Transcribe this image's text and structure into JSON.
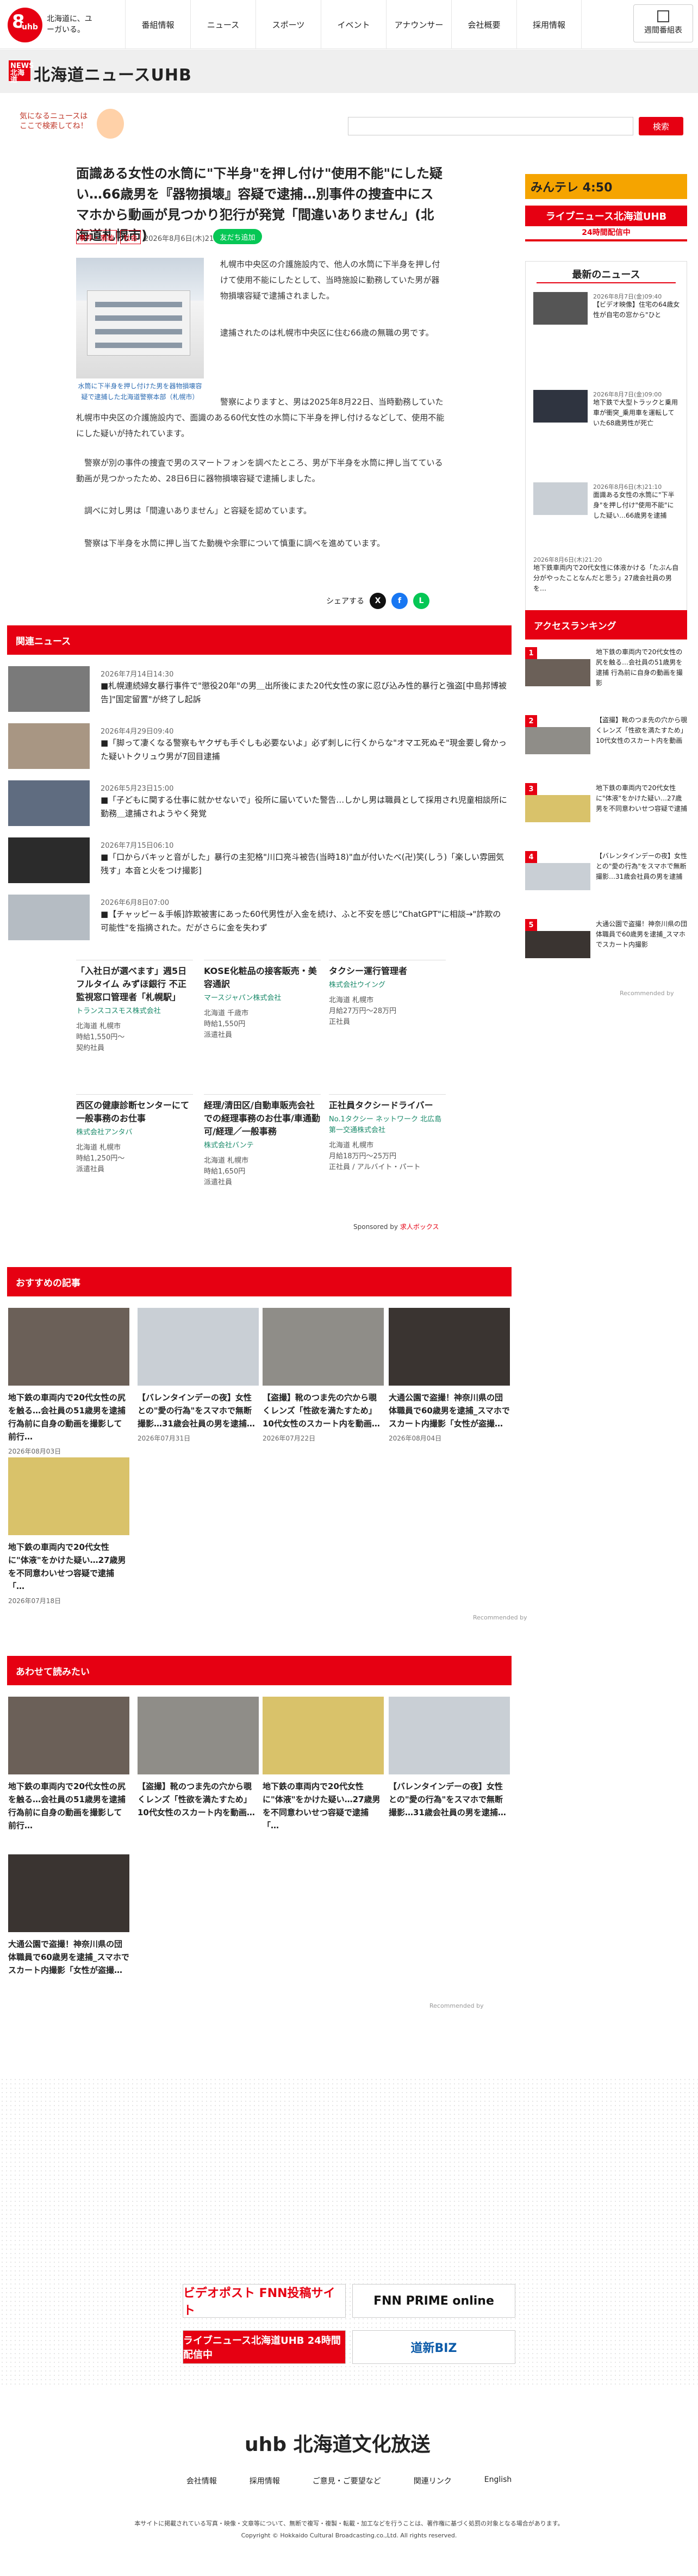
{
  "header": {
    "logo_text": "8 uhb",
    "tagline": "北海道に、ユーガいる。",
    "nav": [
      "番組情報",
      "ニュース",
      "スポーツ",
      "イベント",
      "アナウンサー",
      "会社概要",
      "採用情報"
    ],
    "week_button": "週間番組表"
  },
  "brand": {
    "badge": "NEWS 北海道",
    "title": "北海道ニュースUHB"
  },
  "search": {
    "character_text": "気になるニュースは ここで検索してね！",
    "placeholder": "",
    "button": "検索"
  },
  "article": {
    "title": "面識ある女性の水筒に\"下半身\"を押し付け\"使用不能\"にした疑い…66歳男を『器物損壊』容疑で逮捕…別事件の捜査中にスマホから動画が見つかり犯行が発覚「間違いありません」(北海道札幌市)",
    "tags": [
      "事件・事故",
      "社会"
    ],
    "date": "2026年8月6日(木)21:10",
    "follow": "友だち追加",
    "caption": "水筒に下半身を押し付けた男を器物損壊容疑で逮捕した北海道警察本部（札幌市）",
    "paragraphs": [
      "札幌市中央区の介護施設内で、他人の水筒に下半身を押し付けて使用不能にしたとして、当時施設に勤務していた男が器物損壊容疑で逮捕されました。",
      "逮捕されたのは札幌市中央区に住む66歳の無職の男です。",
      "警察によりますと、男は2025年8月22日、当時勤務していた札幌市中央区の介護施設内で、面識のある60代女性の水筒に下半身を押し付けるなどして、使用不能にした疑いが持たれています。",
      "警察が別の事件の捜査で男のスマートフォンを調べたところ、男が下半身を水筒に押し当てている動画が見つかったため、28日6日に器物損壊容疑で逮捕しました。",
      "調べに対し男は「間違いありません」と容疑を認めています。",
      "警察は下半身を水筒に押し当てた動機や余罪について慎重に調べを進めています。"
    ],
    "share_label": "シェアする"
  },
  "related": {
    "heading": "関連ニュース",
    "items": [
      {
        "date": "2026年7月14日14:30",
        "title": "■札幌連続婦女暴行事件で\"懲役20年\"の男＿出所後にまた20代女性の家に忍び込み性的暴行と強盗[中島邦博被告]\"国定留置\"が終了し起訴"
      },
      {
        "date": "2026年4月29日09:40",
        "title": "■「脚って凄くなる警察もヤクザも手ぐしも必要ないよ」必ず刺しに行くからな\"オマエ死ぬそ\"現金要し脅かった疑いトクリュウ男が7回目逮捕"
      },
      {
        "date": "2026年5月23日15:00",
        "title": "■「子どもに関する仕事に就かせないで」役所に届いていた警告…しかし男は職員として採用され児童相談所に勤務＿逮捕されようやく発覚"
      },
      {
        "date": "2026年7月15日06:10",
        "title": "■「口からバキッと音がした」暴行の主犯格\"川口亮斗被告(当時18)\"血が付いたべ(卍)笑(しう)「楽しい雰囲気残す」本音と火をつけ撮影]"
      },
      {
        "date": "2026年6月8日07:00",
        "title": "■【チャッピー＆手帳]詐欺被害にあった60代男性が入金を続け、ふと不安を感じ\"ChatGPT\"に相談→\"詐欺の可能性\"を指摘された。だがさらに金を失わず"
      }
    ]
  },
  "jobs": [
    {
      "title": "「入社日が選べます」週5日フルタイム みずほ銀行 不正監視窓口管理者「札幌駅」",
      "company": "トランスコスモス株式会社",
      "info": [
        "北海道 札幌市",
        "時給1,550円～",
        "契約社員"
      ]
    },
    {
      "title": "KOSE化粧品の接客販売・美容通訳",
      "company": "マースジャパン株式会社",
      "info": [
        "北海道 千歳市",
        "時給1,550円",
        "派遣社員"
      ]
    },
    {
      "title": "タクシー運行管理者",
      "company": "株式会社ウイング",
      "info": [
        "北海道 札幌市",
        "月給27万円～28万円",
        "正社員"
      ]
    },
    {
      "title": "西区の健康診断センターにて一般事務のお仕事",
      "company": "株式会社アンタバ",
      "info": [
        "北海道 札幌市",
        "時給1,250円～",
        "派遣社員"
      ]
    },
    {
      "title": "経理/清田区/自動車販売会社での経理事務のお仕事/車通勤可/経理／一般事務",
      "company": "株式会社バンテ",
      "info": [
        "北海道 札幌市",
        "時給1,650円",
        "派遣社員"
      ]
    },
    {
      "title": "正社員タクシードライバー",
      "company": "No.1タクシー ネットワーク 北広島第一交通株式会社",
      "info": [
        "北海道 札幌市",
        "月給18万円～25万円",
        "正社員 / アルバイト・パート"
      ]
    }
  ],
  "sponsor": {
    "prefix": "Sponsored by",
    "name": "求人ボックス"
  },
  "recommend": {
    "heading": "おすすめの記事",
    "items": [
      {
        "title": "地下鉄の車両内で20代女性の尻を触る…会社員の51歳男を逮捕 行為前に自身の動画を撮影して前行…",
        "date": "2026年08月03日"
      },
      {
        "title": "【バレンタインデーの夜】女性との\"愛の行為\"をスマホで無断撮影…31歳会社員の男を逮捕…",
        "date": "2026年07月31日"
      },
      {
        "title": "【盗撮】靴のつま先の穴から覗くレンズ「性欲を満たすため」10代女性のスカート内を動画…",
        "date": "2026年07月22日"
      },
      {
        "title": "大通公園で盗撮！神奈川県の団体職員で60歳男を逮捕_スマホでスカート内撮影「女性が盗撮…",
        "date": "2026年08月04日"
      },
      {
        "title": "地下鉄の車両内で20代女性に\"体液\"をかけた疑い…27歳男を不同意わいせつ容疑で逮捕「…",
        "date": "2026年07月18日"
      }
    ],
    "powered": "Recommended by"
  },
  "together": {
    "heading": "あわせて読みたい",
    "items": [
      {
        "title": "地下鉄の車両内で20代女性の尻を触る…会社員の51歳男を逮捕 行為前に自身の動画を撮影して前行…"
      },
      {
        "title": "【盗撮】靴のつま先の穴から覗くレンズ「性欲を満たすため」10代女性のスカート内を動画…"
      },
      {
        "title": "地下鉄の車両内で20代女性に\"体液\"をかけた疑い…27歳男を不同意わいせつ容疑で逮捕「…"
      },
      {
        "title": "【バレンタインデーの夜】女性との\"愛の行為\"をスマホで無断撮影…31歳会社員の男を逮捕…"
      },
      {
        "title": "大通公園で盗撮！神奈川県の団体職員で60歳男を逮捕_スマホでスカート内撮影「女性が盗撮…"
      }
    ],
    "powered": "Recommended by"
  },
  "sidebar": {
    "promo": "みんテレ 4:50",
    "live": "ライブニュース北海道UHB",
    "live_sub": "24時間配信中",
    "new_heading": "最新のニュース",
    "news": [
      {
        "date": "2026年8月7日(金)09:40",
        "title": "【ビデオ映像】住宅の64歳女性が自宅の窓から\"ひと"
      },
      {
        "date": "2026年8月7日(金)09:00",
        "title": "地下鉄で大型トラックと乗用車が衝突_乗用車を運転していた68歳男性が死亡"
      },
      {
        "date": "2026年8月6日(木)21:10",
        "title": "面識ある女性の水筒に\"下半身\"を押し付け\"使用不能\"にした疑い…66歳男を逮捕"
      },
      {
        "date": "2026年8月6日(木)21:20",
        "title": "地下鉄車両内で20代女性に体液かける「たぶん自分がやったことなんだと思う」27歳会社員の男を…"
      }
    ],
    "ranking_heading": "アクセスランキング",
    "ranking": [
      {
        "rank": "1",
        "title": "地下鉄の車両内で20代女性の尻を触る…会社員の51歳男を逮捕 行為前に自身の動画を撮影"
      },
      {
        "rank": "2",
        "title": "【盗撮】靴のつま先の穴から覗くレンズ「性欲を満たすため」10代女性のスカート内を動画"
      },
      {
        "rank": "3",
        "title": "地下鉄の車両内で20代女性に\"体液\"をかけた疑い…27歳男を不同意わいせつ容疑で逮捕"
      },
      {
        "rank": "4",
        "title": "【バレンタインデーの夜】女性との\"愛の行為\"をスマホで無断撮影…31歳会社員の男を逮捕"
      },
      {
        "rank": "5",
        "title": "大通公園で盗撮！神奈川県の団体職員で60歳男を逮捕_スマホでスカート内撮影"
      }
    ],
    "ranking_powered": "Recommended by"
  },
  "banners": {
    "videopost": "ビデオポスト FNN投稿サイト",
    "fnn": "FNN PRIME online",
    "live": "ライブニュース北海道UHB 24時間配信中",
    "dosin": "道新BIZ"
  },
  "footer": {
    "logo": "uhb 北海道文化放送",
    "nav": [
      "会社情報",
      "採用情報",
      "ご意見・ご要望など",
      "関連リンク",
      "English"
    ],
    "note": "本サイトに掲載されている写真・映像・文章等について、無断で複写・複製・転載・加工などを行うことは、著作権に基づく処罰の対象となる場合があります。",
    "copyright": "Copyright © Hokkaido Cultural Broadcasting.co.,Ltd. All rights reserved."
  }
}
